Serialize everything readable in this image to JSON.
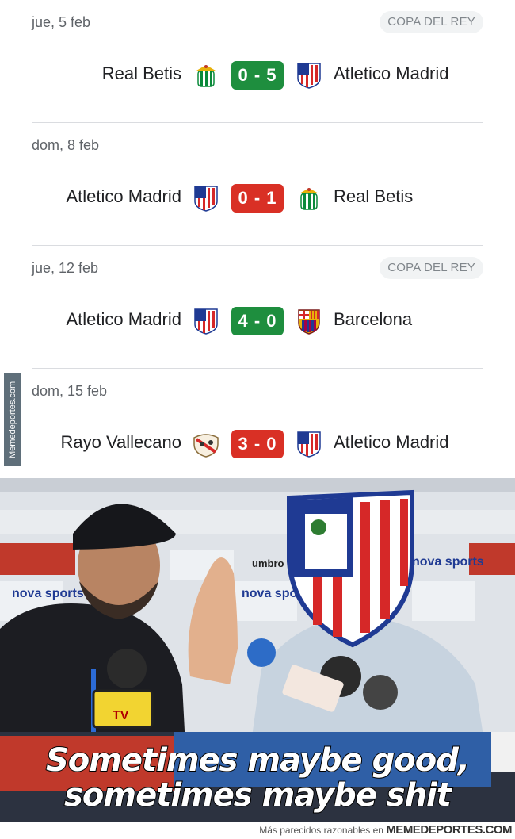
{
  "matches": [
    {
      "date": "jue, 5 feb",
      "competition": "COPA DEL REY",
      "home": "Real Betis",
      "home_crest": "real-betis-crest",
      "score": "0 - 5",
      "away": "Atletico Madrid",
      "away_crest": "atletico-madrid-crest",
      "result": "win"
    },
    {
      "date": "dom, 8 feb",
      "competition": "",
      "home": "Atletico Madrid",
      "home_crest": "atletico-madrid-crest",
      "score": "0 - 1",
      "away": "Real Betis",
      "away_crest": "real-betis-crest",
      "result": "loss"
    },
    {
      "date": "jue, 12 feb",
      "competition": "COPA DEL REY",
      "home": "Atletico Madrid",
      "home_crest": "atletico-madrid-crest",
      "score": "4 - 0",
      "away": "Barcelona",
      "away_crest": "barcelona-crest",
      "result": "win"
    },
    {
      "date": "dom, 15 feb",
      "competition": "",
      "home": "Rayo Vallecano",
      "home_crest": "rayo-vallecano-crest",
      "score": "3 - 0",
      "away": "Atletico Madrid",
      "away_crest": "atletico-madrid-crest",
      "result": "loss"
    }
  ],
  "colors": {
    "win": "#1e8e3e",
    "loss": "#d93025",
    "divider": "#dadce0",
    "muted": "#5f6368"
  },
  "side_watermark": "Memedeportes.com",
  "meme": {
    "caption_line1": "Sometimes maybe good,",
    "caption_line2": "sometimes maybe shit",
    "backdrop_text_1": "nova sports",
    "backdrop_text_2": "umbro",
    "mic_label": "TV"
  },
  "footer": {
    "prefix": "Más parecidos razonables en",
    "brand": "MEMEDEPORTES.COM"
  }
}
